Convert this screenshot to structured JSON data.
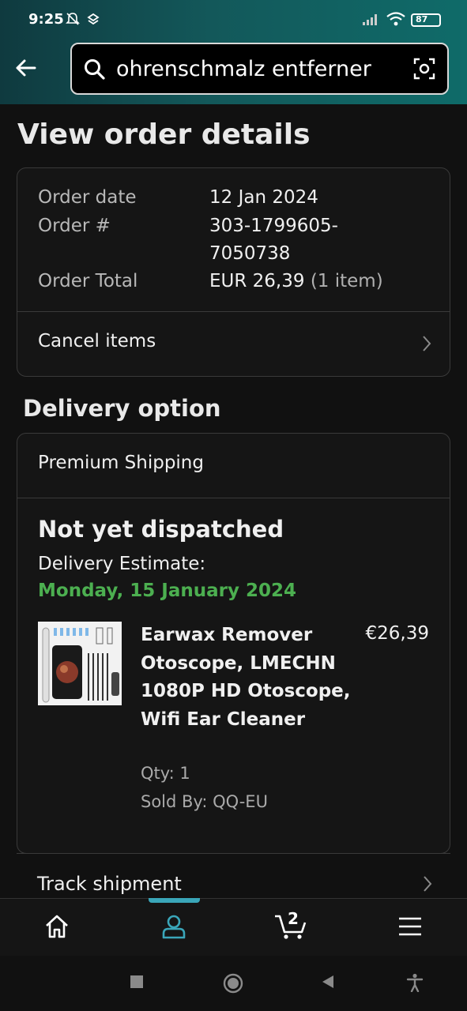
{
  "status": {
    "time": "9:25",
    "battery": "87"
  },
  "search": {
    "query": "ohrenschmalz entferner"
  },
  "page": {
    "title": "View order details"
  },
  "order": {
    "date_label": "Order date",
    "date_value": "12 Jan 2024",
    "number_label": "Order #",
    "number_line1": "303-1799605-",
    "number_line2": "7050738",
    "total_label": "Order Total",
    "total_value": "EUR 26,39",
    "total_items": "(1 item)",
    "cancel_label": "Cancel items"
  },
  "delivery": {
    "heading": "Delivery option",
    "shipping_method": "Premium Shipping",
    "status": "Not yet dispatched",
    "estimate_label": "Delivery Estimate:",
    "estimate_date": "Monday, 15 January 2024",
    "estimate_color": "#4caf50"
  },
  "item": {
    "name": "Earwax Remover Otoscope, LMECHN 1080P HD Otoscope, Wifi Ear Cleaner",
    "price": "€26,39",
    "qty": "Qty: 1",
    "sold_by": "Sold By: QQ-EU"
  },
  "track": {
    "label": "Track shipment"
  },
  "bottom_nav": {
    "items": [
      "home-icon",
      "account-icon",
      "cart-icon",
      "menu-icon"
    ],
    "cart_count": "2",
    "active_color": "#3aa6b9"
  },
  "system_nav": {
    "items": [
      "recents-button",
      "home-button",
      "back-button",
      "accessibility-button"
    ]
  }
}
